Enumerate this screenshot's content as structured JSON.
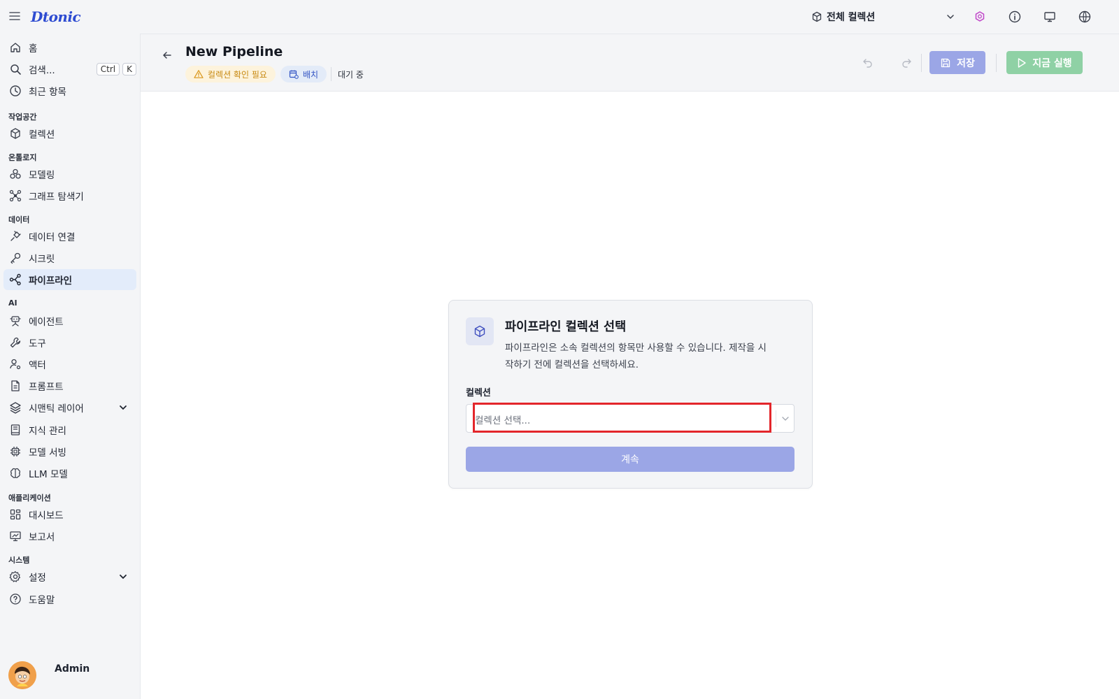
{
  "app": {
    "logo": "Dtonic",
    "collection_switch": "전체 컬렉션"
  },
  "top_icons": [
    "sparkle-gem-icon",
    "info-icon",
    "monitor-icon",
    "globe-icon"
  ],
  "sidebar": {
    "home": "홈",
    "search": "검색...",
    "search_kbd1": "Ctrl",
    "search_kbd2": "K",
    "recent": "최근 항목",
    "sections": {
      "workspace": "작업공간",
      "ontology": "온톨로지",
      "data": "데이터",
      "ai": "AI",
      "apps": "애플리케이션",
      "system": "시스템"
    },
    "items": {
      "collection": "컬렉션",
      "modeling": "모델링",
      "graph_explorer": "그래프 탐색기",
      "data_connection": "데이터 연결",
      "secret": "시크릿",
      "pipeline": "파이프라인",
      "agent": "에이전트",
      "tool": "도구",
      "actor": "액터",
      "prompt": "프롬프트",
      "semantic_layer": "시맨틱 레이어",
      "knowledge": "지식 관리",
      "model_serving": "모델 서빙",
      "llm_model": "LLM 모델",
      "dashboard": "대시보드",
      "report": "보고서",
      "settings": "설정",
      "help": "도움말"
    },
    "user": "Admin"
  },
  "header": {
    "title": "New Pipeline",
    "warn_badge": "컬렉션 확인 필요",
    "batch_badge": "배치",
    "status": "대기 중",
    "save": "저장",
    "run": "지금 실행"
  },
  "dialog": {
    "title": "파이프라인 컬렉션 선택",
    "description": "파이프라인은 소속 컬렉션의 항목만 사용할 수 있습니다. 제작을 시작하기 전에 컬렉션을 선택하세요.",
    "field_label": "컬렉션",
    "placeholder": "컬렉션 선택...",
    "continue": "계속"
  },
  "colors": {
    "accent": "#2d4bd1",
    "save_button": "#9ba6e6",
    "run_button": "#8fd1a5",
    "active_nav": "#e3ecfa",
    "highlight": "#e3262b"
  }
}
